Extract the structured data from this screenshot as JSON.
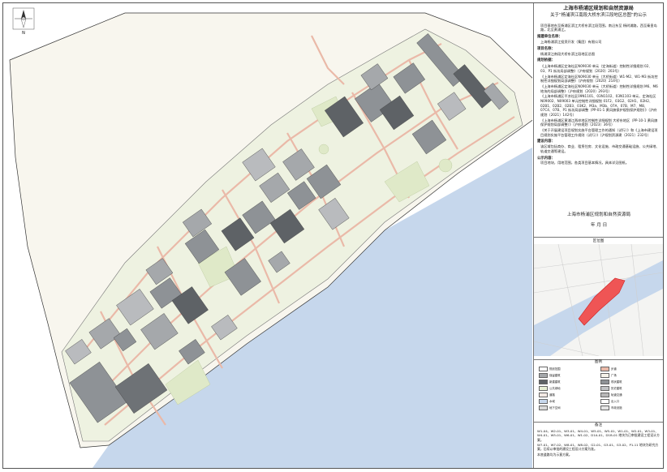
{
  "compass": {
    "label": "N"
  },
  "header": {
    "org": "上海市杨浦区规划和自然资源局",
    "title": "关于“杨浦滨江南段大桥东滨江段地区总图”的公示"
  },
  "sections": [
    {
      "heading": "",
      "body": "项目基地东至杨浦区滨江大桥东滨江段范围，南沿东至 杨树浦路，西至秦皇岛路，北至黄浦江。"
    },
    {
      "heading": "报建单位名称：",
      "body": "上海杨浦滨江投资开发（集团）有限公司"
    },
    {
      "heading": "项目名称：",
      "body": "杨浦滨江南段大桥东滨江段地区总图"
    },
    {
      "heading": "规划依据：",
      "body": ""
    }
  ],
  "references": [
    "《上海市杨浦区定海社区N09030 单元（定海街道）控制性详细规划 02、03、P1 街坊局部调整》（沪府规划〔2020〕203号）",
    "《上海市杨浦区定海社区N09030 单元（大桥街道）W1-M2、W1-M3 街坊控制性详细规划局部调整》（沪府规划〔2020〕214号）",
    "《上海市杨浦区定海社区N09030 单元（大桥街道）控制性详细规划 M6、M6 地块的局部调整》（沪府规划〔2020〕293号）",
    "《上海市杨浦区平凉社区09N1101、03N1102、03N1103 单元、定海社区N09002、N09003 单元控制性详细规划 01F2、03G2、02H1、02H2、02B1、02B2、02B3、03K2、M3a、M3b、07A、07B、M7、M8、07C4、07B、P1 街坊局部调整（PP-01-1 黄风旗保护规划保护规划）》（沪府规划〔2021〕142号）",
    "《上海市杨浦区黄浦江两岸地区控制性详细规划 大桥东地区（PP-10-1 黄风旗保护规划局部调整）》（沪府规划〔2023〕36号）",
    "《关于开展建设项目规划实施平台管理工作的通知（试行）》和《上海市建设项目规划实施平台管理工作规则（试行）》（沪规划资源建〔2021〕232号）"
  ],
  "sections2": [
    {
      "heading": "建设内容：",
      "body": "该区域包括商办、商业、租赁住房、文化设施、市政交通基础设施、公共绿地、轨道交通等建设。"
    },
    {
      "heading": "公示内容：",
      "body": "项目地块，用地范围，各类项目基本情况，具体详见图纸。"
    }
  ],
  "signature": {
    "org": "上海市杨浦区规划和自然资源局",
    "date": "年    月    日"
  },
  "location": {
    "heading": "区位图"
  },
  "legend": {
    "heading": "图例",
    "items": [
      {
        "label": "规划范围",
        "color": "#ffffff"
      },
      {
        "label": "保留建筑",
        "color": "#a5a8ab"
      },
      {
        "label": "新建建筑",
        "color": "#5e6266"
      },
      {
        "label": "公共绿地",
        "color": "#e8efd5"
      },
      {
        "label": "道路",
        "color": "#f3e9e4"
      },
      {
        "label": "水域",
        "color": "#c6d7ec"
      },
      {
        "label": "地下空间",
        "color": "#d9d9d9"
      },
      {
        "label": "步道",
        "color": "#eab9a8"
      },
      {
        "label": "广场",
        "color": "#f6f3ea"
      },
      {
        "label": "现状建筑",
        "color": "#8e9296"
      },
      {
        "label": "历史建筑",
        "color": "#c0c2c4"
      },
      {
        "label": "轨道交通",
        "color": "#b8b8b8"
      },
      {
        "label": "出入口",
        "color": "#ffffff"
      },
      {
        "label": "市政设施",
        "color": "#e4e4e4"
      }
    ]
  },
  "notes": {
    "heading": "备注",
    "lines": [
      "W1-04、W2-01、W3-01、W4-01、W5-01、W5-01、W1-01、W2-01、W3-01、W4-01、W5-01、W6-01、W1-02、D1A-01、D1B-01 地块为已审批建设工程设计方案。",
      "W7-01、W7-02、W8-01、W8-02、G2-01、G3-01、G3-02、P1-11 地块为研究方案，后续以审批的建设工程设计方案为准。",
      "本底道路均为示意方案。"
    ]
  },
  "colors": {
    "water": "#c6d7ec",
    "green": "#e8efd5",
    "road": "#eab9a8",
    "highlight": "#ef5555",
    "building_dark": "#5e6266",
    "building_mid": "#8e9296",
    "building_light": "#b9bbbe"
  }
}
